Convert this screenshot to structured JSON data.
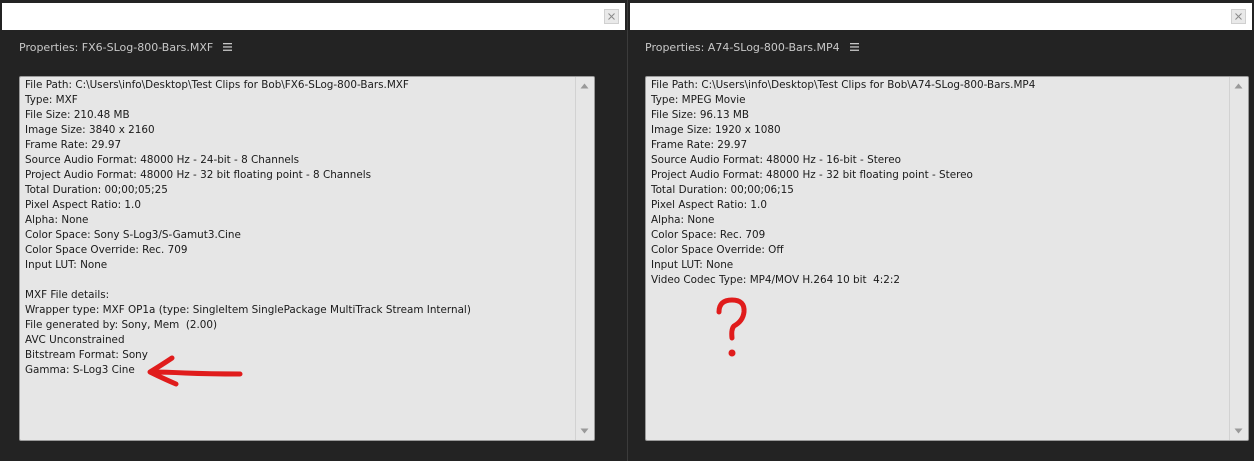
{
  "panels": {
    "left": {
      "title": "Properties: FX6-SLog-800-Bars.MXF",
      "lines": [
        "File Path: C:\\Users\\info\\Desktop\\Test Clips for Bob\\FX6-SLog-800-Bars.MXF",
        "Type: MXF",
        "File Size: 210.48 MB",
        "Image Size: 3840 x 2160",
        "Frame Rate: 29.97",
        "Source Audio Format: 48000 Hz - 24-bit - 8 Channels",
        "Project Audio Format: 48000 Hz - 32 bit floating point - 8 Channels",
        "Total Duration: 00;00;05;25",
        "Pixel Aspect Ratio: 1.0",
        "Alpha: None",
        "Color Space: Sony S-Log3/S-Gamut3.Cine",
        "Color Space Override: Rec. 709",
        "Input LUT: None",
        "",
        "MXF File details:",
        "Wrapper type: MXF OP1a (type: SingleItem SinglePackage MultiTrack Stream Internal)",
        "File generated by: Sony, Mem  (2.00)",
        "AVC Unconstrained",
        "Bitstream Format: Sony",
        "Gamma: S-Log3 Cine"
      ]
    },
    "right": {
      "title": "Properties: A74-SLog-800-Bars.MP4",
      "lines": [
        "File Path: C:\\Users\\info\\Desktop\\Test Clips for Bob\\A74-SLog-800-Bars.MP4",
        "Type: MPEG Movie",
        "File Size: 96.13 MB",
        "Image Size: 1920 x 1080",
        "Frame Rate: 29.97",
        "Source Audio Format: 48000 Hz - 16-bit - Stereo",
        "Project Audio Format: 48000 Hz - 32 bit floating point - Stereo",
        "Total Duration: 00;00;06;15",
        "Pixel Aspect Ratio: 1.0",
        "Alpha: None",
        "Color Space: Rec. 709",
        "Color Space Override: Off",
        "Input LUT: None",
        "Video Codec Type: MP4/MOV H.264 10 bit  4:2:2"
      ]
    }
  },
  "icons": {
    "close": "close-icon",
    "menu": "hamburger-menu-icon",
    "scroll_up": "scroll-up-arrow-icon",
    "scroll_down": "scroll-down-arrow-icon"
  },
  "annotations": {
    "color": "#e01c1c",
    "arrow": "red-arrow-pointing-left",
    "question_mark": "?"
  },
  "colors": {
    "panel_bg": "#232323",
    "content_bg": "#e6e6e6",
    "title_text": "#c8c8c8"
  }
}
